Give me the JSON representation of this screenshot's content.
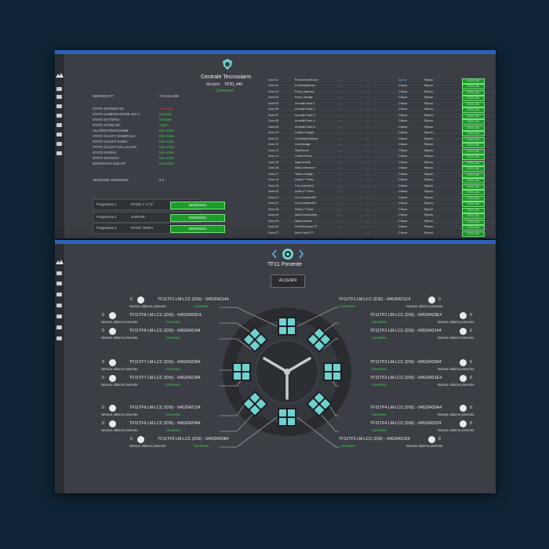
{
  "window1": {
    "title": "Centrale Tecnosiarm",
    "model_label": "Modello",
    "model_value": "TP20_440",
    "status": "Connesso",
    "info": [
      {
        "label": "INDIRIZZO IP:",
        "value": "172.16.0.230",
        "state": "normal"
      },
      {
        "label": "STATO SISTEMA OK:",
        "value": "Anomalia",
        "state": "alert"
      },
      {
        "label": "STATO ALIMENTAZIONE 230 V:",
        "value": "Normale",
        "state": "ok"
      },
      {
        "label": "STATO BATTERIA:",
        "value": "Normale",
        "state": "ok"
      },
      {
        "label": "STATO STAND-BY:",
        "value": "Attivo",
        "state": "ok"
      },
      {
        "label": "ALLARMI PROGRAMMI:",
        "value": "Non Attivo",
        "state": "ok"
      },
      {
        "label": "STATO GUASTI GENERALE:",
        "value": "Non Attivo",
        "state": "ok"
      },
      {
        "label": "STATO GUASTI RADIO:",
        "value": "Non Attivo",
        "state": "ok"
      },
      {
        "label": "STATO GUASTI CELLULARE:",
        "value": "Non Attivo",
        "state": "ok"
      },
      {
        "label": "STATO RAPINA:",
        "value": "Non Attivo",
        "state": "ok"
      },
      {
        "label": "STATO TECNICO:",
        "value": "Non Attivo",
        "state": "ok"
      },
      {
        "label": "DISPOSITIVI ISOLATI:",
        "value": "Non Attivo",
        "state": "ok"
      },
      {
        "label": "VERSIONE FIRMWARE:",
        "value": "2.3",
        "state": "normal"
      }
    ],
    "programs": [
      {
        "label": "Programma 1",
        "value": "PIANO 1°,2°,3°",
        "button": "INSERISCI"
      },
      {
        "label": "Programma 2",
        "value": "GARAGE",
        "button": "INSERISCI"
      },
      {
        "label": "Programma 3",
        "value": "PIANO TERRA",
        "button": "INSERISCI"
      }
    ],
    "zones": [
      {
        "zone": "Zona 01",
        "name": "PortaControlRoom",
        "state": "Aperta",
        "mode": "Riposo",
        "button": "ESCLUDI"
      },
      {
        "zone": "Zona 02",
        "name": "PortaSalaServer",
        "state": "Chiusa",
        "mode": "Riposo",
        "button": "ESCLUDI"
      },
      {
        "zone": "Zona 03",
        "name": "Porta_Ingresso",
        "state": "Chiusa",
        "mode": "Riposo",
        "button": "ESCLUDI"
      },
      {
        "zone": "Zona 04",
        "name": "Porta_Garage",
        "state": "Chiusa",
        "mode": "Riposo",
        "button": "ESCLUDI"
      },
      {
        "zone": "Zona 05",
        "name": "Armadio Rack 1",
        "state": "Chiusa",
        "mode": "Riposo",
        "button": "ESCLUDI"
      },
      {
        "zone": "Zona 06",
        "name": "Armadio Rack 2",
        "state": "Chiusa",
        "mode": "Riposo",
        "button": "ESCLUDI"
      },
      {
        "zone": "Zona 07",
        "name": "Armadio Rack 3",
        "state": "Chiusa",
        "mode": "Riposo",
        "button": "ESCLUDI"
      },
      {
        "zone": "Zona 08",
        "name": "Armadio Rack 4",
        "state": "Chiusa",
        "mode": "Riposo",
        "button": "ESCLUDI"
      },
      {
        "zone": "Zona 09",
        "name": "Armadio Rack 5",
        "state": "Chiusa",
        "mode": "Riposo",
        "button": "ESCLUDI"
      },
      {
        "zone": "Zona 10",
        "name": "Lettore Garage",
        "state": "Chiusa",
        "mode": "Riposo",
        "button": "ESCLUDI"
      },
      {
        "zone": "Zona 11",
        "name": "CamSalaConferen",
        "state": "Chiusa",
        "mode": "Riposo",
        "button": "ESCLUDI"
      },
      {
        "zone": "Zona 12",
        "name": "CamGarage",
        "state": "Chiusa",
        "mode": "Riposo",
        "button": "ESCLUDI"
      },
      {
        "zone": "Zona 13",
        "name": "SalaServer",
        "state": "Chiusa",
        "mode": "Riposo",
        "button": "ESCLUDI"
      },
      {
        "zone": "Zona 14",
        "name": "Control Room",
        "state": "Chiusa",
        "mode": "Riposo",
        "button": "ESCLUDI"
      },
      {
        "zone": "Zona 15",
        "name": "IngressoHall",
        "state": "Chiusa",
        "mode": "Riposo",
        "button": "ESCLUDI"
      },
      {
        "zone": "Zona 16",
        "name": "SalaConferenze",
        "state": "Chiusa",
        "mode": "Riposo",
        "button": "ESCLUDI"
      },
      {
        "zone": "Zona 17",
        "name": "Volum.Garage",
        "state": "Chiusa",
        "mode": "Riposo",
        "button": "ESCLUDI"
      },
      {
        "zone": "Zona 18",
        "name": "Scala 2° Piano",
        "state": "Chiusa",
        "mode": "Riposo",
        "button": "ESCLUDI"
      },
      {
        "zone": "Zona 19",
        "name": "Corr.Lato Mont",
        "state": "Chiusa",
        "mode": "Riposo",
        "button": "ESCLUDI"
      },
      {
        "zone": "Zona 20",
        "name": "Scala 3° Piano",
        "state": "Chiusa",
        "mode": "Riposo",
        "button": "ESCLUDI"
      },
      {
        "zone": "Zona 21",
        "name": "Corr.LatoMont3P",
        "state": "Chiusa",
        "mode": "Riposo",
        "button": "ESCLUDI"
      },
      {
        "zone": "Zona 22",
        "name": "Corr.LatoMont1P",
        "state": "Chiusa",
        "mode": "Riposo",
        "button": "ESCLUDI"
      },
      {
        "zone": "Zona 23",
        "name": "Scala 1° Piano",
        "state": "Chiusa",
        "mode": "Riposo",
        "button": "ESCLUDI"
      },
      {
        "zone": "Zona 24",
        "name": "SalaCoordinating",
        "state": "Chiusa",
        "mode": "Riposo",
        "button": "ESCLUDI"
      },
      {
        "zone": "Zona 25",
        "name": "SalaCorridoio",
        "state": "Chiusa",
        "mode": "Riposo",
        "button": "ESCLUDI"
      },
      {
        "zone": "Zona 26",
        "name": "PortaTerrazzo1°P",
        "state": "Chiusa",
        "mode": "Riposo",
        "button": "ESCLUDI"
      },
      {
        "zone": "Zona 27",
        "name": "Infra.Porta 1°P",
        "state": "Chiusa",
        "mode": "Riposo",
        "button": "ESCLUDI"
      }
    ]
  },
  "window2": {
    "title": "TF11 Ponente",
    "accendi_label": "ACCENDI",
    "units_left": [
      {
        "name": "TF11TF1 LM-LCC (DSI) - 6452042144",
        "count": "0",
        "alarm": "Nessun allarme presente",
        "conn": "Connesso"
      },
      {
        "name": "TF11TF8 LM-LCC (DSI) - 64520420C4",
        "count": "0",
        "alarm": "Nessun allarme presente",
        "conn": "Connesso"
      },
      {
        "name": "TF11TF8 LM-LCC (DSI) - 6452042104",
        "count": "0",
        "alarm": "Nessun allarme presente",
        "conn": "Connesso"
      },
      {
        "name": "TF11TF7 LM-LCC (DSI) - 6452042064",
        "count": "0",
        "alarm": "Nessun allarme presente",
        "conn": "Connesso"
      },
      {
        "name": "TF11TF7 LM-LCC (DSI) - 6452042184",
        "count": "0",
        "alarm": "Nessun allarme presente",
        "conn": "Connesso"
      },
      {
        "name": "TF11TF6 LM-LCC (DSI) - 6452042124",
        "count": "0",
        "alarm": "Nessun allarme presente",
        "conn": "Connesso"
      },
      {
        "name": "TF11TF6 LM-LCC (DSI) - 6452042044",
        "count": "0",
        "alarm": "Nessun allarme presente",
        "conn": "Connesso"
      },
      {
        "name": "TF11TF5 LM-LCC (DSI) - 6452042084",
        "count": "0",
        "alarm": "Nessun allarme presente",
        "conn": "Connesso"
      }
    ],
    "units_right": [
      {
        "name": "TF11TF1 LM-LCC (DSI) - 64520421C4",
        "count": "0",
        "alarm": "Nessun allarme presente",
        "conn": "Connesso"
      },
      {
        "name": "TF11TF2 LM-LCC (DSI) - 64520420E4",
        "count": "0",
        "alarm": "Nessun allarme presente",
        "conn": "Connesso"
      },
      {
        "name": "TF11TF2 LM-LCC (DSI) - 6452042144",
        "count": "0",
        "alarm": "Nessun allarme presente",
        "conn": "Connesso"
      },
      {
        "name": "TF11TF3 LM-LCC (DSI) - 6452042004",
        "count": "0",
        "alarm": "Nessun allarme presente",
        "conn": "Connesso"
      },
      {
        "name": "TF11TF3 LM-LCC (DSI) - 64520421E4",
        "count": "0",
        "alarm": "Nessun allarme presente",
        "conn": "Connesso"
      },
      {
        "name": "TF11TF4 LM-LCC (DSI) - 64520420A4",
        "count": "0",
        "alarm": "Nessun allarme presente",
        "conn": "Connesso"
      },
      {
        "name": "TF11TF4 LM-LCC (DSI) - 6452042024",
        "count": "0",
        "alarm": "Nessun allarme presente",
        "conn": "Connesso"
      },
      {
        "name": "TF11TF5 LM-LCC (DSI) - 6452042164",
        "count": "0",
        "alarm": "Nessun allarme presente",
        "conn": "Connesso"
      }
    ]
  },
  "colors": {
    "background": "#0f2436",
    "panel": "#3b3e44",
    "ok_green": "#39d04a",
    "alert_red": "#e03a2e",
    "button_green": "#1d9b2c",
    "lamp_teal": "#6fd2cf"
  }
}
